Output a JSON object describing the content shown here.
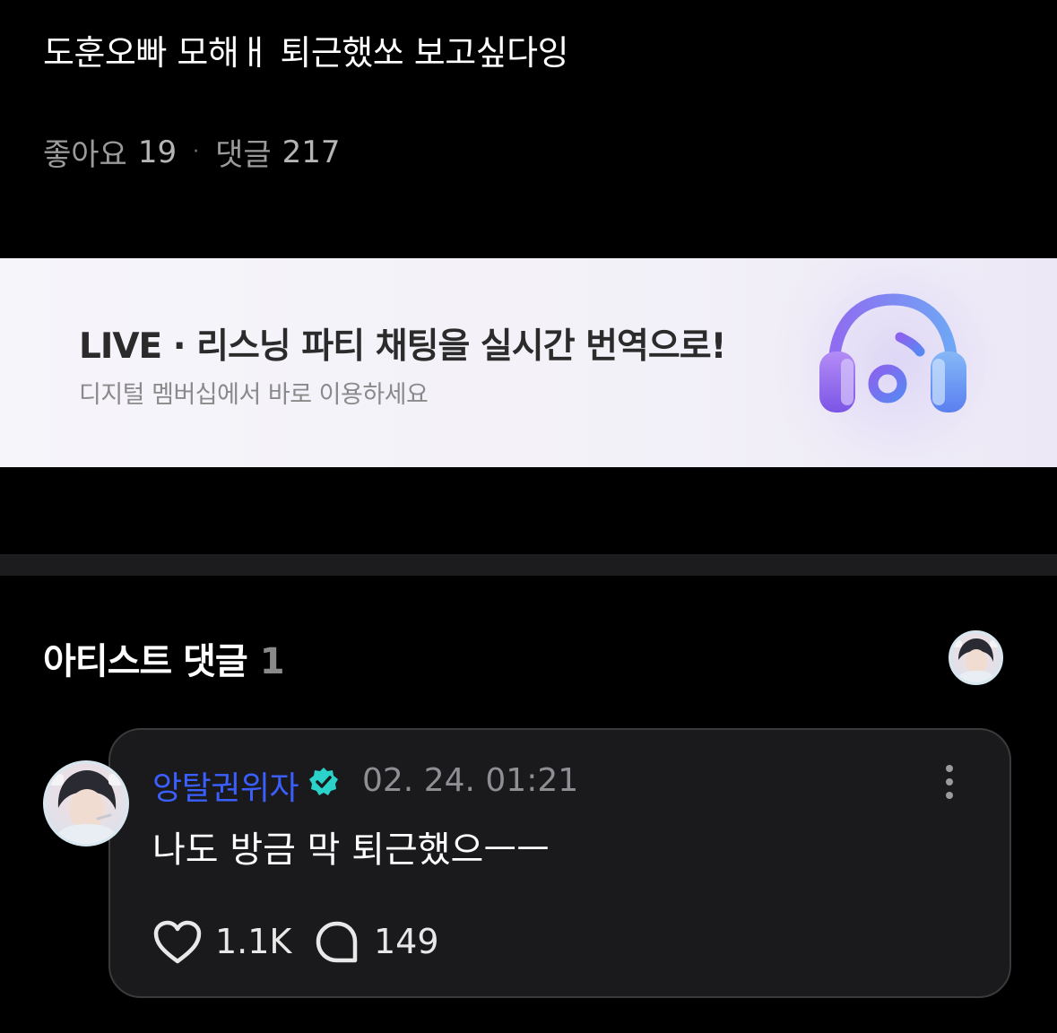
{
  "post": {
    "title": "도훈오빠 모해ㅐ 퇴근했쏘 보고싶다잉",
    "likes_label": "좋아요",
    "likes_count": "19",
    "separator": "·",
    "comments_label": "댓글",
    "comments_count": "217"
  },
  "banner": {
    "headline": "LIVE · 리스닝 파티 채팅을 실시간 번역으로!",
    "subtext": "디지털 멤버십에서 바로 이용하세요",
    "icon": "headphones-music-icon"
  },
  "artist_comments": {
    "title": "아티스트 댓글",
    "count": "1"
  },
  "comment": {
    "author": "앙탈권위자",
    "verified_icon": "verified-badge-icon",
    "timestamp": "02. 24. 01:21",
    "body": "나도 방금 막 퇴근했으ㅡㅡ",
    "like_count": "1.1K",
    "reply_count": "149"
  },
  "colors": {
    "background": "#000000",
    "author_name": "#3b5fff",
    "verified_badge": "#2ad2c9",
    "card_background": "#1a1a1c"
  }
}
